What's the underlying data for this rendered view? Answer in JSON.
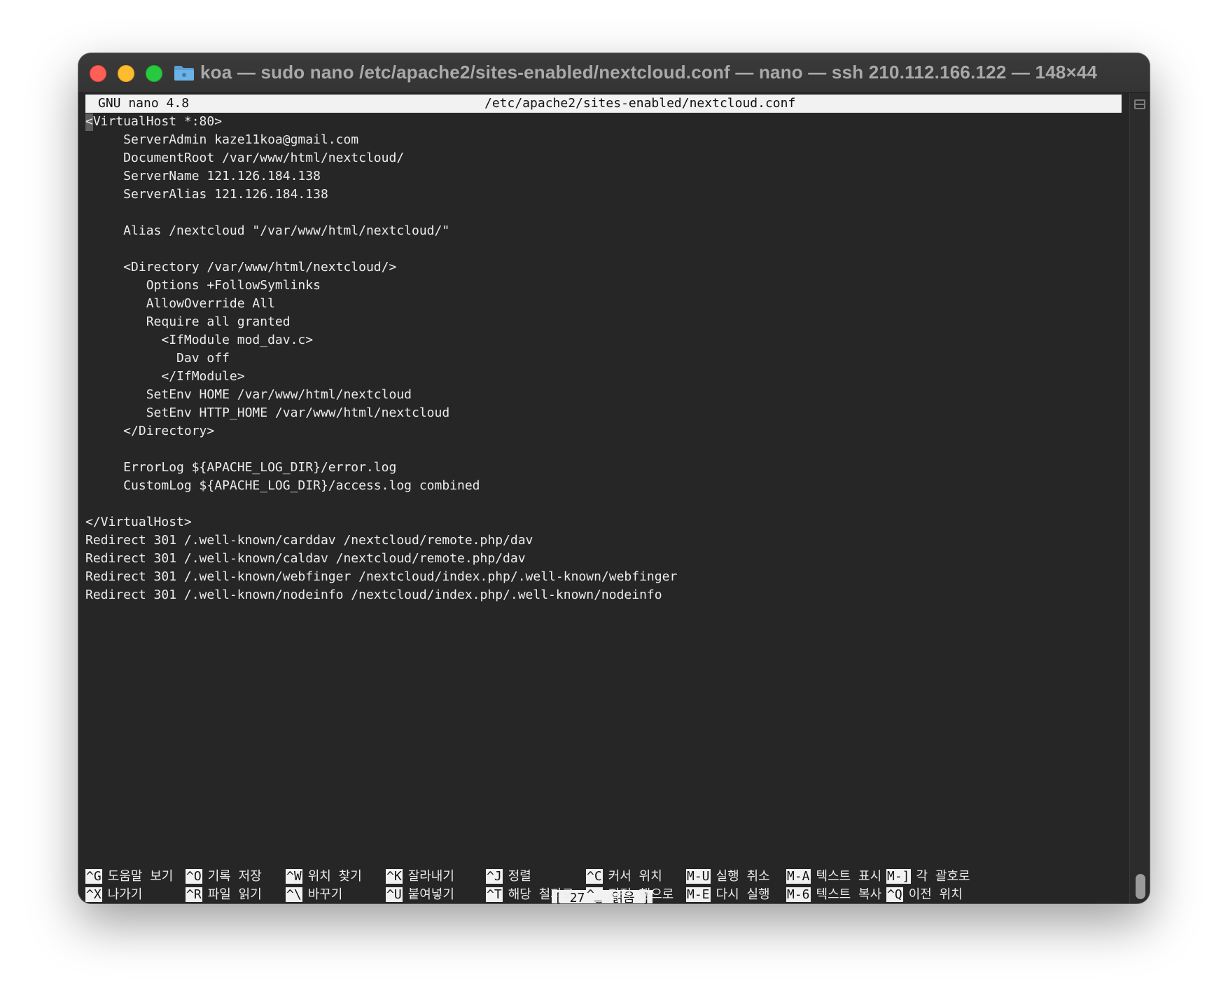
{
  "window": {
    "title": "koa — sudo nano /etc/apache2/sites-enabled/nextcloud.conf — nano — ssh 210.112.166.122 — 148×44"
  },
  "nano": {
    "version": "GNU nano 4.8",
    "filename": "/etc/apache2/sites-enabled/nextcloud.conf",
    "status_message": "[ 27 행 읽음 ]"
  },
  "file_lines": [
    "<VirtualHost *:80>",
    "     ServerAdmin kaze11koa@gmail.com",
    "     DocumentRoot /var/www/html/nextcloud/",
    "     ServerName 121.126.184.138",
    "     ServerAlias 121.126.184.138",
    "",
    "     Alias /nextcloud \"/var/www/html/nextcloud/\"",
    "",
    "     <Directory /var/www/html/nextcloud/>",
    "        Options +FollowSymlinks",
    "        AllowOverride All",
    "        Require all granted",
    "          <IfModule mod_dav.c>",
    "            Dav off",
    "          </IfModule>",
    "        SetEnv HOME /var/www/html/nextcloud",
    "        SetEnv HTTP_HOME /var/www/html/nextcloud",
    "     </Directory>",
    "",
    "     ErrorLog ${APACHE_LOG_DIR}/error.log",
    "     CustomLog ${APACHE_LOG_DIR}/access.log combined",
    "",
    "</VirtualHost>",
    "Redirect 301 /.well-known/carddav /nextcloud/remote.php/dav",
    "Redirect 301 /.well-known/caldav /nextcloud/remote.php/dav",
    "Redirect 301 /.well-known/webfinger /nextcloud/index.php/.well-known/webfinger",
    "Redirect 301 /.well-known/nodeinfo /nextcloud/index.php/.well-known/nodeinfo"
  ],
  "shortcuts": {
    "row1": [
      {
        "key": "^G",
        "label": "도움말 보기"
      },
      {
        "key": "^O",
        "label": "기록 저장"
      },
      {
        "key": "^W",
        "label": "위치 찾기"
      },
      {
        "key": "^K",
        "label": "잘라내기"
      },
      {
        "key": "^J",
        "label": "정렬"
      },
      {
        "key": "^C",
        "label": "커서 위치"
      },
      {
        "key": "M-U",
        "label": "실행 취소"
      },
      {
        "key": "M-A",
        "label": "텍스트 표시"
      },
      {
        "key": "M-]",
        "label": "각 괄호로"
      }
    ],
    "row2": [
      {
        "key": "^X",
        "label": "나가기"
      },
      {
        "key": "^R",
        "label": "파일 읽기"
      },
      {
        "key": "^\\",
        "label": "바꾸기"
      },
      {
        "key": "^U",
        "label": "붙여넣기"
      },
      {
        "key": "^T",
        "label": "해당 철자로"
      },
      {
        "key": "^_",
        "label": "지정 행으로"
      },
      {
        "key": "M-E",
        "label": "다시 실행"
      },
      {
        "key": "M-6",
        "label": "텍스트 복사"
      },
      {
        "key": "^Q",
        "label": "이전 위치"
      }
    ]
  },
  "icons": {
    "close": "close-dot-icon",
    "minimize": "minimize-dot-icon",
    "zoom": "zoom-dot-icon",
    "folder": "folder-icon",
    "scroll": "split-pane-icon"
  },
  "colors": {
    "close": "#fe5f57",
    "minimize": "#febc2e",
    "zoom": "#28c840",
    "terminal_bg": "#262626",
    "folder": "#5aa0d8"
  }
}
